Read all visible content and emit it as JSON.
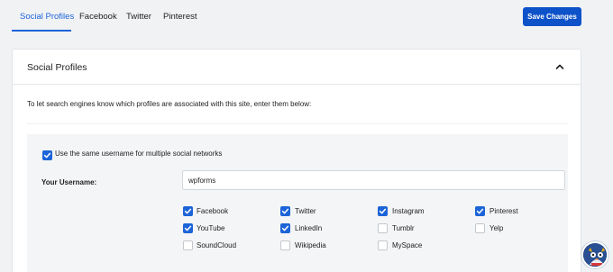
{
  "tabs": [
    {
      "label": "Social Profiles"
    },
    {
      "label": "Facebook"
    },
    {
      "label": "Twitter"
    },
    {
      "label": "Pinterest"
    }
  ],
  "save_button": {
    "label": "Save Changes"
  },
  "card": {
    "title": "Social Profiles",
    "intro": "To let search engines know which profiles are associated with this site, enter them below:",
    "same_username": {
      "label": "Use the same username for multiple social networks",
      "checked": true
    },
    "username": {
      "label": "Your Username:",
      "value": "wpforms"
    },
    "networks": [
      {
        "label": "Facebook",
        "checked": true
      },
      {
        "label": "Twitter",
        "checked": true
      },
      {
        "label": "Instagram",
        "checked": true
      },
      {
        "label": "Pinterest",
        "checked": true
      },
      {
        "label": "YouTube",
        "checked": true
      },
      {
        "label": "LinkedIn",
        "checked": true
      },
      {
        "label": "Tumblr",
        "checked": false
      },
      {
        "label": "Yelp",
        "checked": false
      },
      {
        "label": "SoundCloud",
        "checked": false
      },
      {
        "label": "Wikipedia",
        "checked": false
      },
      {
        "label": "MySpace",
        "checked": false
      }
    ]
  },
  "colors": {
    "accent": "#1c64d8",
    "button": "#0e52c9",
    "page_bg": "#f1f2f4"
  },
  "icons": {
    "collapse": "chevron-up-icon",
    "check": "check-icon",
    "avatar": "mascot-avatar"
  }
}
